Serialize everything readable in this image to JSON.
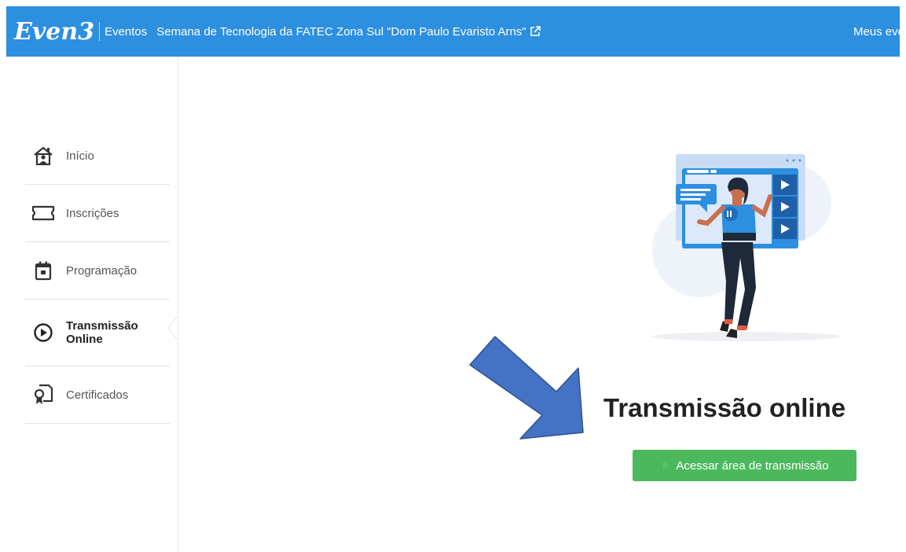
{
  "header": {
    "logo": "Even3",
    "nav_eventos": "Eventos",
    "event_title": "Semana de Tecnologia da FATEC Zona Sul \"Dom Paulo Evaristo Arns\"",
    "meus_eventos": "Meus eve"
  },
  "sidebar": {
    "items": [
      {
        "label": "Início",
        "icon": "home-icon"
      },
      {
        "label": "Inscrições",
        "icon": "ticket-icon"
      },
      {
        "label": "Programação",
        "icon": "calendar-icon"
      },
      {
        "label_line1": "Transmissão",
        "label_line2": "Online",
        "icon": "play-circle-icon",
        "active": true
      },
      {
        "label": "Certificados",
        "icon": "certificate-icon"
      }
    ]
  },
  "main": {
    "title": "Transmissão online",
    "button_label": "Acessar área de transmissão"
  },
  "colors": {
    "header_bg": "#2d8fe0",
    "button_bg": "#4cb85c",
    "arrow": "#4472c4"
  }
}
